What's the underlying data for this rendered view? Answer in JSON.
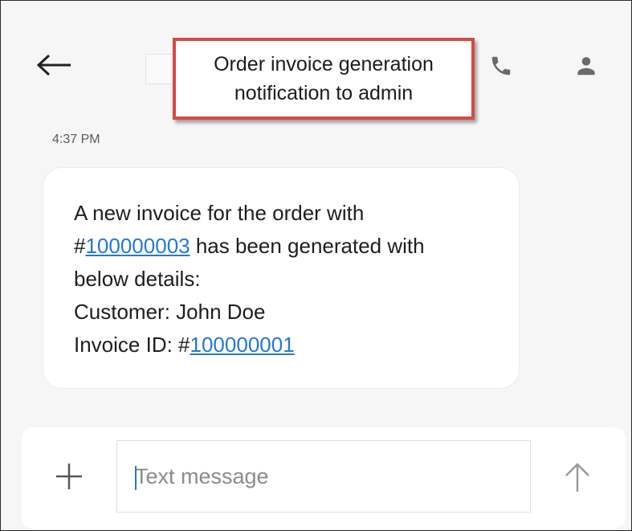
{
  "header": {
    "back_icon": "arrow-left-icon",
    "callout_line1": "Order invoice generation",
    "callout_line2": "notification to admin",
    "call_icon": "phone-icon",
    "contact_icon": "person-icon"
  },
  "conversation": {
    "timestamp": "4:37 PM",
    "message": {
      "line1": "A new invoice for the order with",
      "line2_prefix": "#",
      "order_number": "100000003",
      "line2_suffix": " has been generated with",
      "line3": "below details:",
      "line4": "Customer: John Doe",
      "line5_prefix": "Invoice ID: #",
      "invoice_number": "100000001"
    }
  },
  "composer": {
    "add_icon": "plus-icon",
    "placeholder": "Text message",
    "value": "",
    "send_icon": "arrow-up-icon"
  },
  "colors": {
    "link": "#2478d4",
    "callout_border": "#d54b44",
    "background": "#f6f6f6",
    "bubble": "#ffffff"
  }
}
